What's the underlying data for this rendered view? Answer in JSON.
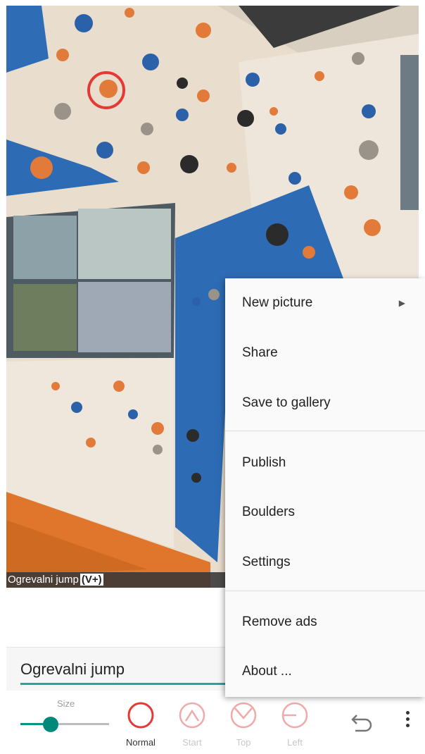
{
  "photo": {
    "caption_name": "Ogrevalni jump",
    "caption_grade": "(V+)"
  },
  "route_name_input": {
    "value": "Ogrevalni jump"
  },
  "toolbar": {
    "size_label": "Size",
    "size_level": 0.34,
    "modes": [
      {
        "label": "Normal",
        "icon": "circle-icon",
        "active": true
      },
      {
        "label": "Start",
        "icon": "start-hold-icon",
        "active": false
      },
      {
        "label": "Top",
        "icon": "top-hold-icon",
        "active": false
      },
      {
        "label": "Left",
        "icon": "left-hand-icon",
        "active": false
      }
    ],
    "undo_icon": "undo-icon",
    "overflow_icon": "more-vert-icon"
  },
  "menu": {
    "items": [
      {
        "label": "New picture",
        "submenu": true
      },
      {
        "label": "Share"
      },
      {
        "label": "Save to gallery"
      },
      {
        "label": "Publish"
      },
      {
        "label": "Boulders"
      },
      {
        "label": "Settings"
      },
      {
        "label": "Remove ads"
      },
      {
        "label": "About ..."
      }
    ]
  },
  "colors": {
    "accent": "#26a69a",
    "mark_red": "#e53935",
    "wall_blue": "#2e6bb5"
  }
}
